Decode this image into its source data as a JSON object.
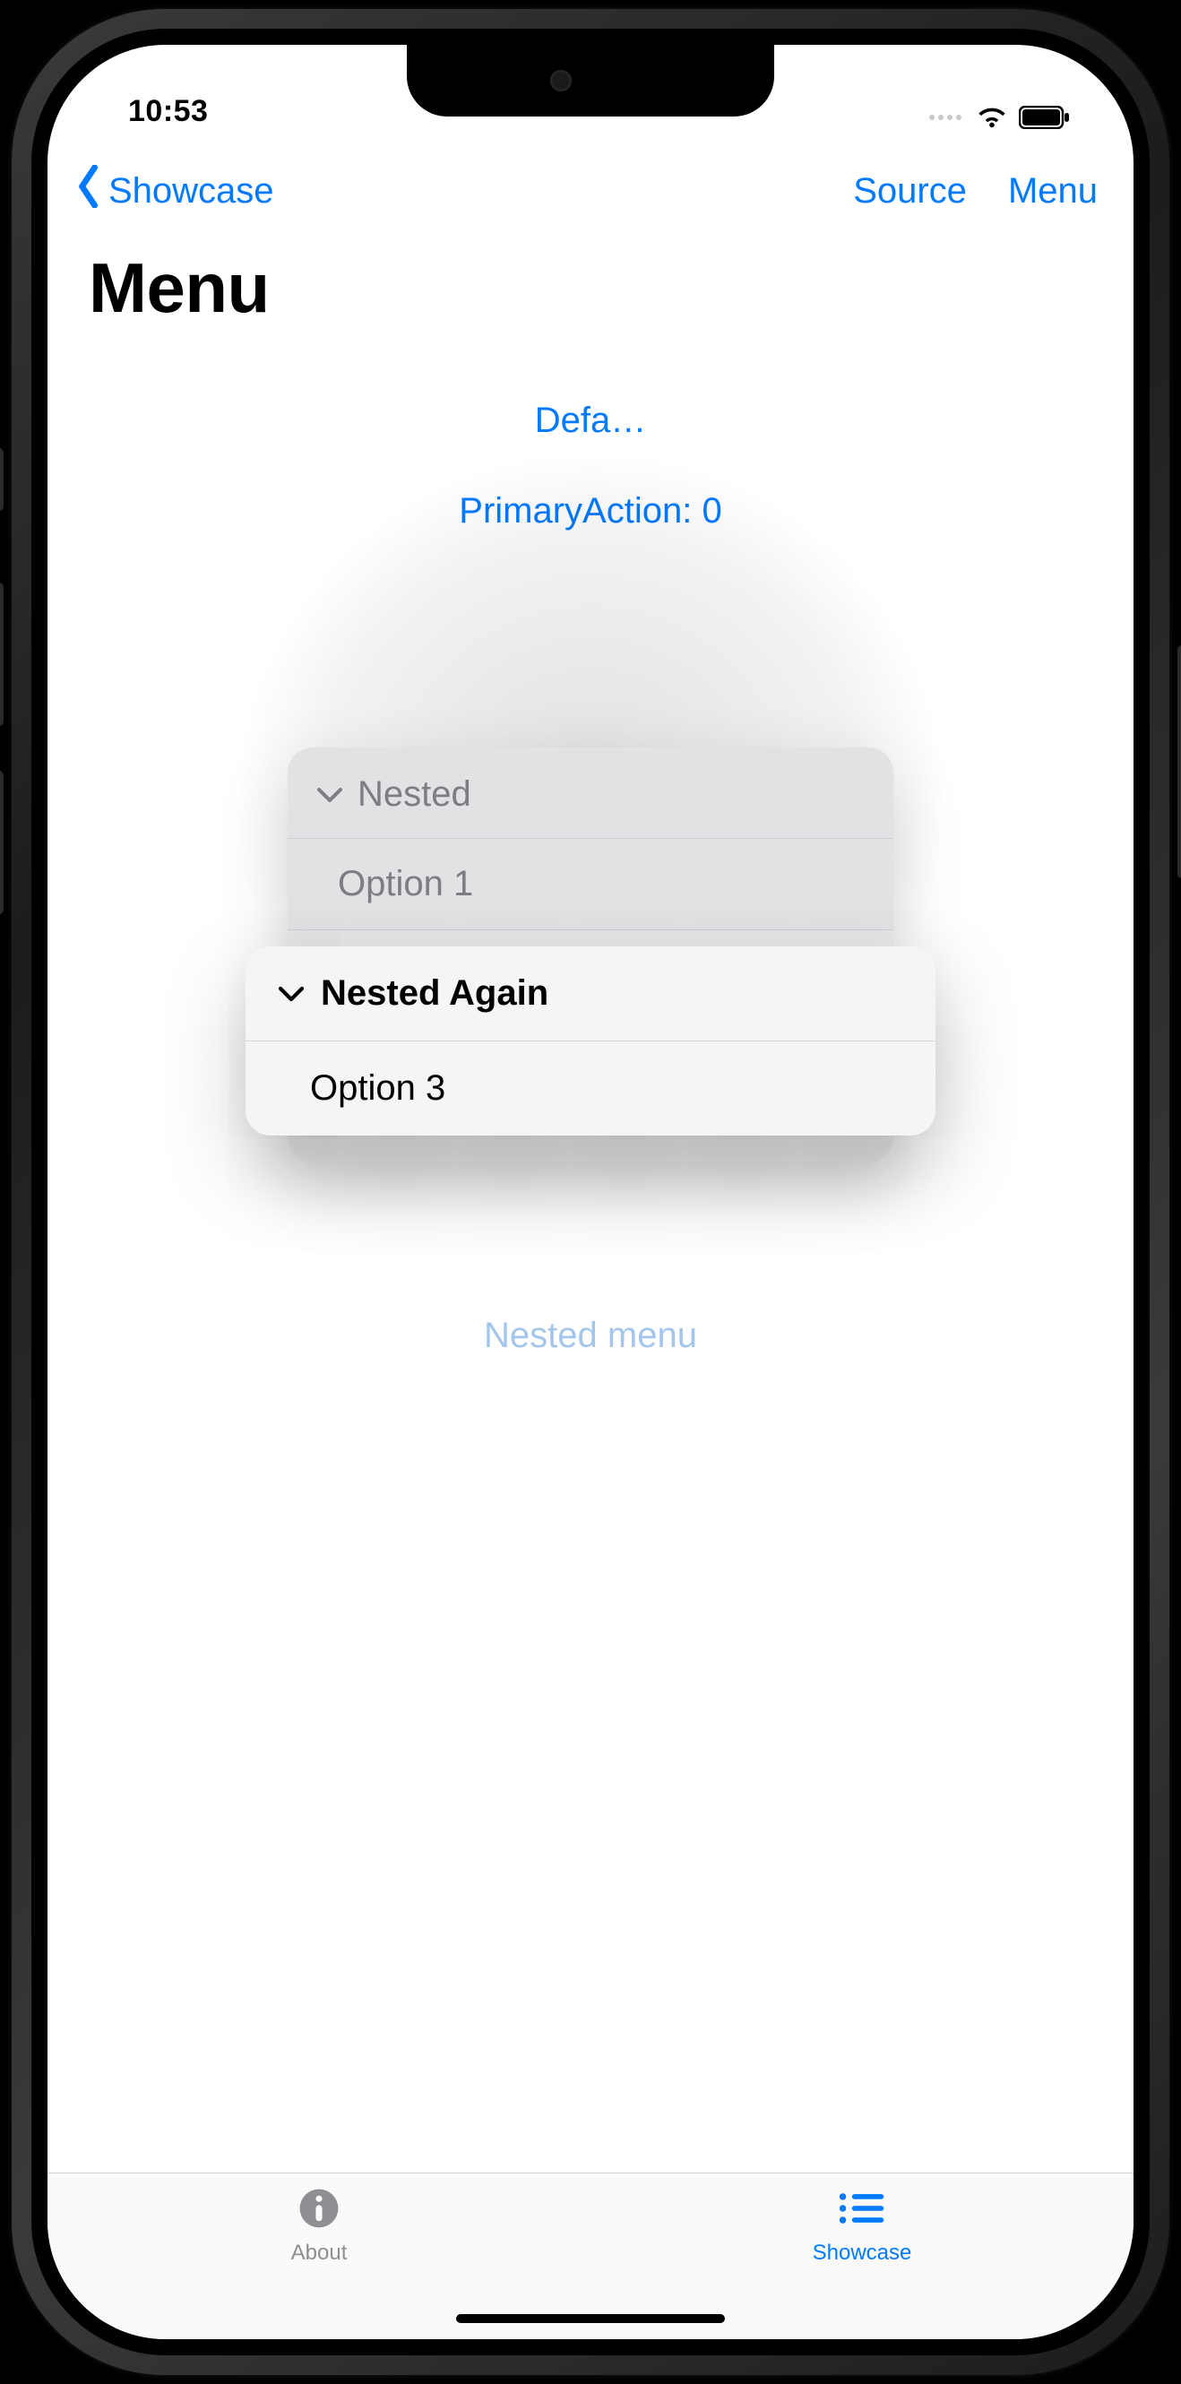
{
  "status": {
    "time": "10:53"
  },
  "nav": {
    "back_label": "Showcase",
    "source_label": "Source",
    "menu_label": "Menu"
  },
  "title": "Menu",
  "links": {
    "defa": "Defa…",
    "primary_action": "PrimaryAction: 0",
    "nested_menu": "Nested menu"
  },
  "back_menu": {
    "header": "Nested",
    "option1": "Option 1"
  },
  "front_menu": {
    "nested_again": "Nested Again",
    "option3": "Option 3"
  },
  "tabs": {
    "about": "About",
    "showcase": "Showcase"
  }
}
